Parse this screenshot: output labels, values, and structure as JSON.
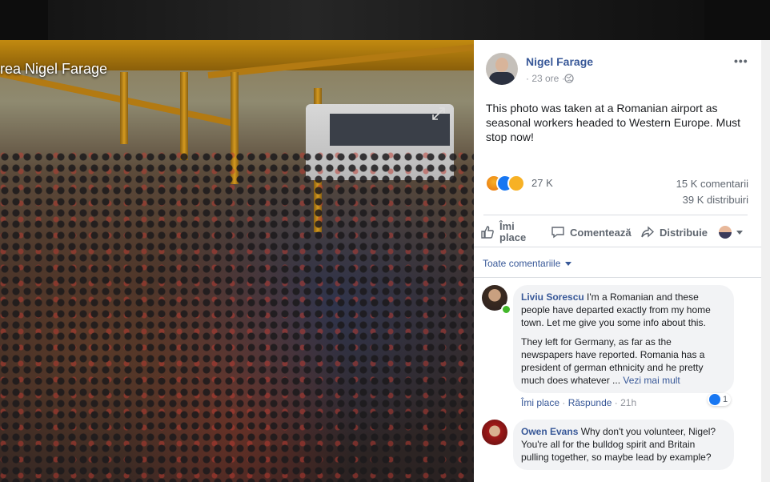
{
  "photo": {
    "title_fragment": "rea Nigel Farage"
  },
  "post": {
    "author": "Nigel Farage",
    "time": "· 23 ore ·",
    "text": "This photo was taken at a Romanian airport as seasonal workers headed to Western Europe. Must stop now!",
    "reactions_count": "27 K",
    "comments_count": "15 K comentarii",
    "shares_count": "39 K distribuiri"
  },
  "actions": {
    "like": "Îmi place",
    "comment": "Comentează",
    "share": "Distribuie"
  },
  "comments_sort": "Toate comentariile",
  "comments": [
    {
      "author": "Liviu Sorescu",
      "paragraphs": [
        "I'm a Romanian and these people have departed exactly from my home town. Let me give you some info about this.",
        "They left for Germany, as far as the newspapers have reported. Romania has a president of german ethnicity and he pretty much does whatever ..."
      ],
      "see_more": "Vezi mai mult",
      "like": "Îmi place",
      "reply": "Răspunde",
      "time": "21h",
      "reaction_count": "1"
    },
    {
      "author": "Owen Evans",
      "paragraphs": [
        "Why don't you volunteer, Nigel?",
        "You're all for the bulldog spirit and Britain pulling together, so maybe lead by example?"
      ]
    }
  ],
  "icons": [
    "expand-icon",
    "globe-icon",
    "more-icon",
    "like-icon",
    "comment-icon",
    "share-icon",
    "caret-down-icon"
  ],
  "colors": {
    "link": "#385898",
    "like_blue": "#1877f2",
    "online": "#42b72a",
    "bubble": "#f2f3f5"
  }
}
